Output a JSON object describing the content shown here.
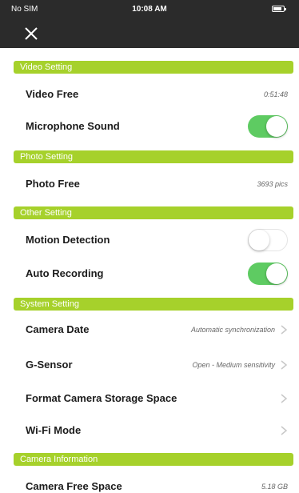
{
  "status_bar": {
    "carrier": "No SIM",
    "time": "10:08 AM"
  },
  "header": {
    "close_icon": "close-icon"
  },
  "colors": {
    "section_header": "#a6d12b",
    "toggle_on": "#5ecb62",
    "status_bar_bg": "#2b2b2b"
  },
  "sections": {
    "video": {
      "title": "Video Setting",
      "video_free": {
        "label": "Video Free",
        "value": "0:51:48"
      },
      "microphone_sound": {
        "label": "Microphone Sound",
        "enabled": true
      }
    },
    "photo": {
      "title": "Photo Setting",
      "photo_free": {
        "label": "Photo Free",
        "value": "3693 pics"
      }
    },
    "other": {
      "title": "Other Setting",
      "motion_detection": {
        "label": "Motion Detection",
        "enabled": false
      },
      "auto_recording": {
        "label": "Auto Recording",
        "enabled": true
      }
    },
    "system": {
      "title": "System Setting",
      "camera_date": {
        "label": "Camera Date",
        "value": "Automatic synchronization"
      },
      "g_sensor": {
        "label": "G-Sensor",
        "value": "Open - Medium sensitivity"
      },
      "format_storage": {
        "label": "Format Camera Storage Space"
      },
      "wifi_mode": {
        "label": "Wi-Fi Mode"
      }
    },
    "camera_info": {
      "title": "Camera Information",
      "camera_free_space": {
        "label": "Camera Free Space",
        "value": "5.18 GB"
      }
    }
  }
}
